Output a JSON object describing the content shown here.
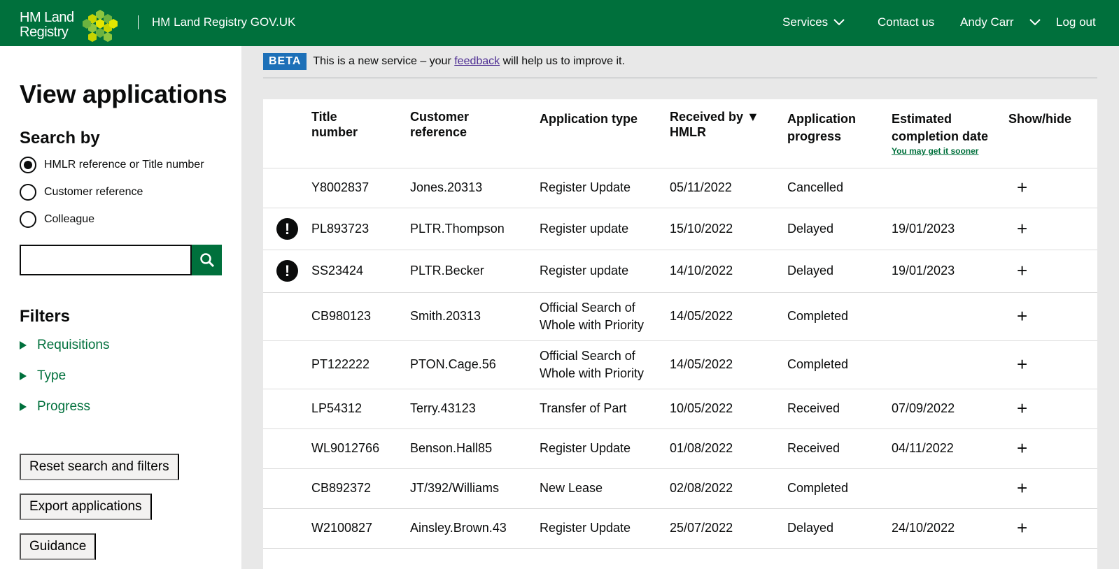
{
  "header": {
    "logo_line1": "HM Land",
    "logo_line2": "Registry",
    "service_name": "HM Land Registry GOV.UK",
    "nav": {
      "services": "Services",
      "contact": "Contact us",
      "user": "Andy Carr",
      "logout": "Log out"
    },
    "colors": {
      "background": "#00703c"
    }
  },
  "sidebar": {
    "title": "View applications",
    "search_heading": "Search by",
    "radios": [
      {
        "label": "HMLR reference or Title number",
        "checked": true
      },
      {
        "label": "Customer reference",
        "checked": false
      },
      {
        "label": "Colleague",
        "checked": false
      }
    ],
    "search_value": "",
    "search_icon": "search-icon",
    "filters_heading": "Filters",
    "filters": [
      "Requisitions",
      "Type",
      "Progress"
    ],
    "buttons": {
      "reset": "Reset search and filters",
      "export": "Export applications",
      "guidance": "Guidance"
    }
  },
  "beta": {
    "tag": "BETA",
    "text_before": "This is a new service – your ",
    "link": "feedback",
    "text_after": " will help us to improve it."
  },
  "table": {
    "headers": {
      "title_number": "Title number",
      "customer_reference": "Customer reference",
      "application_type": "Application type",
      "received": "Received by ▼ HMLR",
      "progress": "Application progress",
      "estimated": "Estimated completion date",
      "estimated_note": "You may get it sooner",
      "show_hide": "Show/hide"
    },
    "rows": [
      {
        "warning": false,
        "title": "Y8002837",
        "ref": "Jones.20313",
        "type": "Register Update",
        "received": "05/11/2022",
        "progress": "Cancelled",
        "estimated": ""
      },
      {
        "warning": true,
        "title": "PL893723",
        "ref": "PLTR.Thompson",
        "type": "Register update",
        "received": "15/10/2022",
        "progress": "Delayed",
        "estimated": "19/01/2023"
      },
      {
        "warning": true,
        "title": "SS23424",
        "ref": "PLTR.Becker",
        "type": "Register update",
        "received": "14/10/2022",
        "progress": "Delayed",
        "estimated": "19/01/2023"
      },
      {
        "warning": false,
        "title": "CB980123",
        "ref": "Smith.20313",
        "type": "Official Search of Whole with Priority",
        "received": "14/05/2022",
        "progress": "Completed",
        "estimated": ""
      },
      {
        "warning": false,
        "title": "PT122222",
        "ref": "PTON.Cage.56",
        "type": "Official Search of Whole with Priority",
        "received": "14/05/2022",
        "progress": "Completed",
        "estimated": ""
      },
      {
        "warning": false,
        "title": "LP54312",
        "ref": "Terry.43123",
        "type": "Transfer of Part",
        "received": "10/05/2022",
        "progress": "Received",
        "estimated": "07/09/2022"
      },
      {
        "warning": false,
        "title": "WL9012766",
        "ref": "Benson.Hall85",
        "type": "Register Update",
        "received": "01/08/2022",
        "progress": "Received",
        "estimated": "04/11/2022"
      },
      {
        "warning": false,
        "title": "CB892372",
        "ref": "JT/392/Williams",
        "type": "New Lease",
        "received": "02/08/2022",
        "progress": "Completed",
        "estimated": ""
      },
      {
        "warning": false,
        "title": "W2100827",
        "ref": "Ainsley.Brown.43",
        "type": "Register Update",
        "received": "25/07/2022",
        "progress": "Delayed",
        "estimated": "24/10/2022"
      }
    ],
    "warning_glyph": "!",
    "expand_glyph": "+"
  }
}
